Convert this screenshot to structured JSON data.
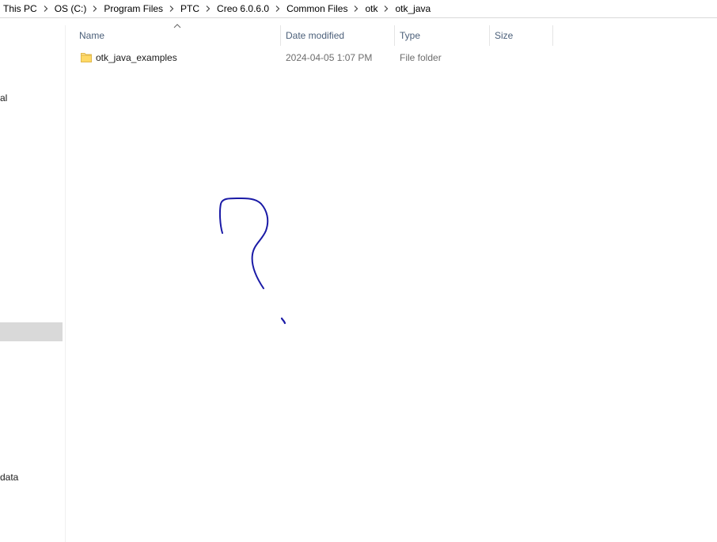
{
  "breadcrumb": {
    "items": [
      "This PC",
      "OS (C:)",
      "Program Files",
      "PTC",
      "Creo 6.0.6.0",
      "Common Files",
      "otk",
      "otk_java"
    ]
  },
  "nav_pane": {
    "items": [
      {
        "label": "al"
      },
      {
        "label": "data"
      }
    ],
    "colors": {
      "selected_bg": "#d9d9d9"
    }
  },
  "columns": {
    "name": "Name",
    "date_modified": "Date modified",
    "type": "Type",
    "size": "Size"
  },
  "files": [
    {
      "name": "otk_java_examples",
      "date_modified": "2024-04-05 1:07 PM",
      "type": "File folder",
      "size": "",
      "icon": "folder-icon"
    }
  ],
  "annotation": {
    "shape": "question-mark",
    "color": "#1a1aa6"
  }
}
